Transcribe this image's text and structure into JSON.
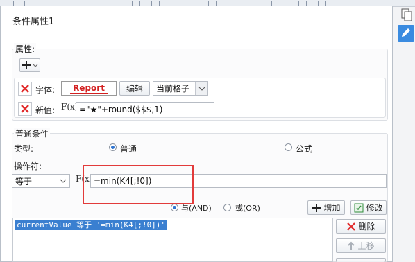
{
  "dialog": {
    "title": "条件属性1",
    "properties_legend": "属性:",
    "font_label": "字体:",
    "font_preview": "Report",
    "edit_button": "编辑",
    "scope_select": "当前格子",
    "new_value_label": "新值:",
    "new_value_formula": "=\"★\"+round($$$,1)",
    "conditions_legend": "普通条件",
    "type_label": "类型:",
    "type_normal": "普通",
    "type_formula": "公式",
    "operator_label": "操作符:",
    "operator_value": "等于",
    "operand_value": "=min(K4[;!0])",
    "and_label": "与(AND)",
    "or_label": "或(OR)",
    "add_button": "增加",
    "modify_button": "修改",
    "delete_button": "删除",
    "up_button": "上移",
    "condition_text": "currentValue 等于 '=min(K4[;!0])'",
    "selected_type": "普通",
    "selected_logic": "与(AND)"
  },
  "fx_label": "F(x)",
  "colors": {
    "highlight_box": "#e23b3b",
    "selection": "#3a7fd0",
    "report_text": "#d32020"
  }
}
